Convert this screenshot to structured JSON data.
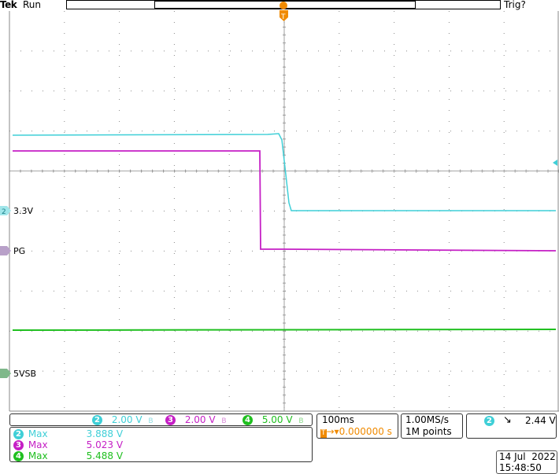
{
  "header": {
    "brand": "Tek",
    "status": "Run",
    "trigger_status": "Trig?"
  },
  "channels": [
    {
      "id": "2",
      "name": "3.3V",
      "color": "#3fcfd7",
      "scale": "2.00 V"
    },
    {
      "id": "3",
      "name": "PG",
      "color": "#c51fc5",
      "scale": "2.00 V"
    },
    {
      "id": "4",
      "name": "5VSB",
      "color": "#1fbf1f",
      "scale": "5.00 V"
    }
  ],
  "timebase": {
    "horizontal": "100ms",
    "trigger_position": "0.000000 s",
    "sample_rate": "1.00MS/s",
    "record_length": "1M points"
  },
  "trigger": {
    "source": "2",
    "slope_icon": "falling-edge-icon",
    "level": "2.44 V"
  },
  "measurements": [
    {
      "channel": "2",
      "label": "Max",
      "value": "3.888 V",
      "color": "#3fcfd7"
    },
    {
      "channel": "3",
      "label": "Max",
      "value": "5.023 V",
      "color": "#c51fc5"
    },
    {
      "channel": "4",
      "label": "Max",
      "value": "5.488 V",
      "color": "#1fbf1f"
    }
  ],
  "datetime": {
    "date": "14 Jul  2022",
    "time": "15:48:50"
  },
  "colors": {
    "ch2": "#3fcfd7",
    "ch3": "#c51fc5",
    "ch4": "#1fbf1f",
    "trigger_marker": "#f08a00",
    "grid": "#8a8a8a"
  }
}
